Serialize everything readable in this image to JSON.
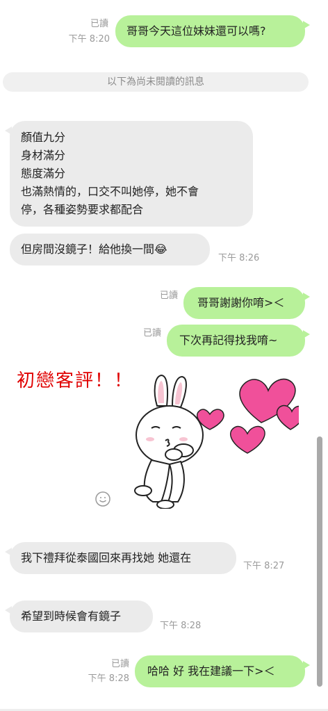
{
  "messages": {
    "m1": {
      "read": "已讀",
      "time": "下午 8:20",
      "text": "哥哥今天這位妹妹還可以嗎?"
    },
    "divider": "以下為尚未閱讀的訊息",
    "m2": {
      "lines": [
        "顏值九分",
        "身材滿分",
        "態度滿分",
        "也滿熱情的，口交不叫她停，她不會",
        "停，各種姿勢要求都配合"
      ]
    },
    "m3": {
      "text": "但房間沒鏡子！給他換一間😂",
      "time": "下午 8:26"
    },
    "m4": {
      "read": "已讀",
      "text": "哥哥謝謝你唷>＜"
    },
    "m5": {
      "read": "已讀",
      "text": "下次再記得找我唷~"
    },
    "caption": "初戀客評！！",
    "m6": {
      "text": "我下禮拜從泰國回來再找她 她還在",
      "time": "下午 8:27"
    },
    "m7": {
      "text": "希望到時候會有鏡子",
      "time": "下午 8:28"
    },
    "m8": {
      "read": "已讀",
      "time": "下午 8:28",
      "text": "哈哈 好 我在建議一下>＜"
    }
  },
  "colors": {
    "outgoing_bubble": "#b8f19a",
    "incoming_bubble": "#ebebeb",
    "caption_red": "#e00000",
    "heart_pink": "#f0509a"
  },
  "icons": {
    "sticker": "bunny-blowing-kiss-with-hearts",
    "smiley": "smiley-icon"
  }
}
